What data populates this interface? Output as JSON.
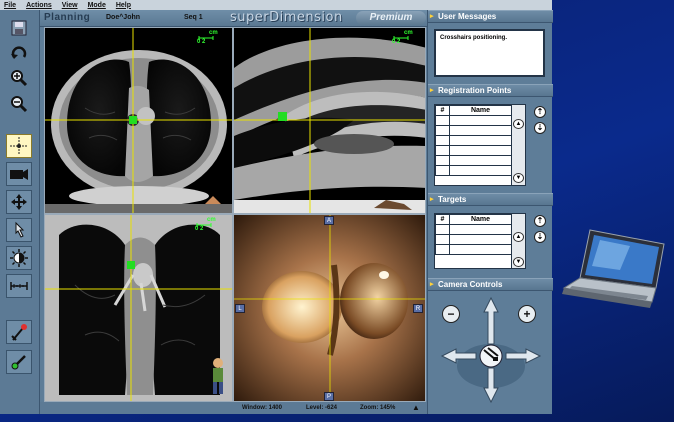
{
  "menu": {
    "items": [
      "File",
      "Actions",
      "View",
      "Mode",
      "Help"
    ]
  },
  "header": {
    "mode_title": "Planning",
    "patient": "Doe^John",
    "sequence": "Seq 1",
    "brand": "superDimension",
    "edition": "Premium"
  },
  "toolbar": {
    "tools": [
      "save-icon",
      "undo-icon",
      "zoom-in-icon",
      "zoom-out-icon",
      "crosshair-icon",
      "camera-icon",
      "pan-icon",
      "pointer-icon",
      "window-level-icon",
      "measure-icon",
      "registration-tool-icon",
      "target-tool-icon"
    ],
    "active_tool": "crosshair-icon"
  },
  "viewports": {
    "axial": {
      "scale_unit": "cm",
      "scale_values": "0 2"
    },
    "sagittal": {
      "scale_unit": "cm",
      "scale_values": "0 2"
    },
    "coronal": {
      "scale_unit": "cm",
      "scale_values": "0 2"
    },
    "endoscopic": {
      "labels": {
        "top": "A",
        "bottom": "P",
        "left": "L",
        "right": "R"
      }
    }
  },
  "status": {
    "window": "Window: 1400",
    "level": "Level: -624",
    "zoom": "Zoom: 145%"
  },
  "right_panel": {
    "messages": {
      "title": "User Messages",
      "text": "Crosshairs positioning."
    },
    "registration": {
      "title": "Registration Points",
      "columns": [
        "#",
        "Name"
      ],
      "rows": 6
    },
    "targets": {
      "title": "Targets",
      "columns": [
        "#",
        "Name"
      ],
      "rows": 3
    },
    "camera": {
      "title": "Camera Controls",
      "zoom_out": "−",
      "zoom_in": "+"
    }
  },
  "colors": {
    "accent": "#ffd23a",
    "crosshair": "#e8e100",
    "marker": "#22dd22",
    "panel": "#5e7d98",
    "background": "#0a2a8c"
  }
}
